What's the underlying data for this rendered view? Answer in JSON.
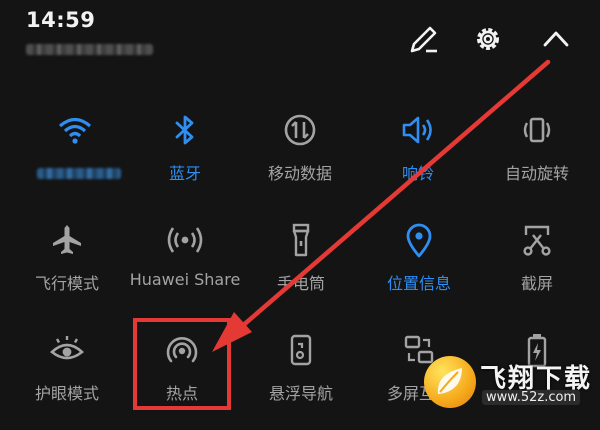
{
  "status_bar": {
    "time": "14:59"
  },
  "header_icons": [
    "edit-icon",
    "settings-icon",
    "collapse-chevron-icon"
  ],
  "colors": {
    "active": "#2f8ef2",
    "inactive": "#a3a3a3",
    "highlight": "#e53935",
    "background": "#141414"
  },
  "tiles": [
    {
      "label": "",
      "icon": "wifi-icon",
      "active": true
    },
    {
      "label": "蓝牙",
      "icon": "bluetooth-icon",
      "active": true
    },
    {
      "label": "移动数据",
      "icon": "mobile-data-icon",
      "active": false
    },
    {
      "label": "响铃",
      "icon": "ring-icon",
      "active": true
    },
    {
      "label": "自动旋转",
      "icon": "auto-rotate-icon",
      "active": false
    },
    {
      "label": "飞行模式",
      "icon": "airplane-icon",
      "active": false
    },
    {
      "label": "Huawei Share",
      "icon": "huawei-share-icon",
      "active": false
    },
    {
      "label": "手电筒",
      "icon": "flashlight-icon",
      "active": false
    },
    {
      "label": "位置信息",
      "icon": "location-icon",
      "active": true
    },
    {
      "label": "截屏",
      "icon": "screenshot-icon",
      "active": false
    },
    {
      "label": "护眼模式",
      "icon": "eye-comfort-icon",
      "active": false
    },
    {
      "label": "热点",
      "icon": "hotspot-icon",
      "active": false
    },
    {
      "label": "悬浮导航",
      "icon": "floating-nav-icon",
      "active": false
    },
    {
      "label": "多屏互动",
      "icon": "multi-screen-icon",
      "active": false
    },
    {
      "label": "",
      "icon": "battery-saver-icon",
      "active": false
    }
  ],
  "watermark": {
    "brand": "飞翔下载",
    "url": "www.52z.com"
  }
}
